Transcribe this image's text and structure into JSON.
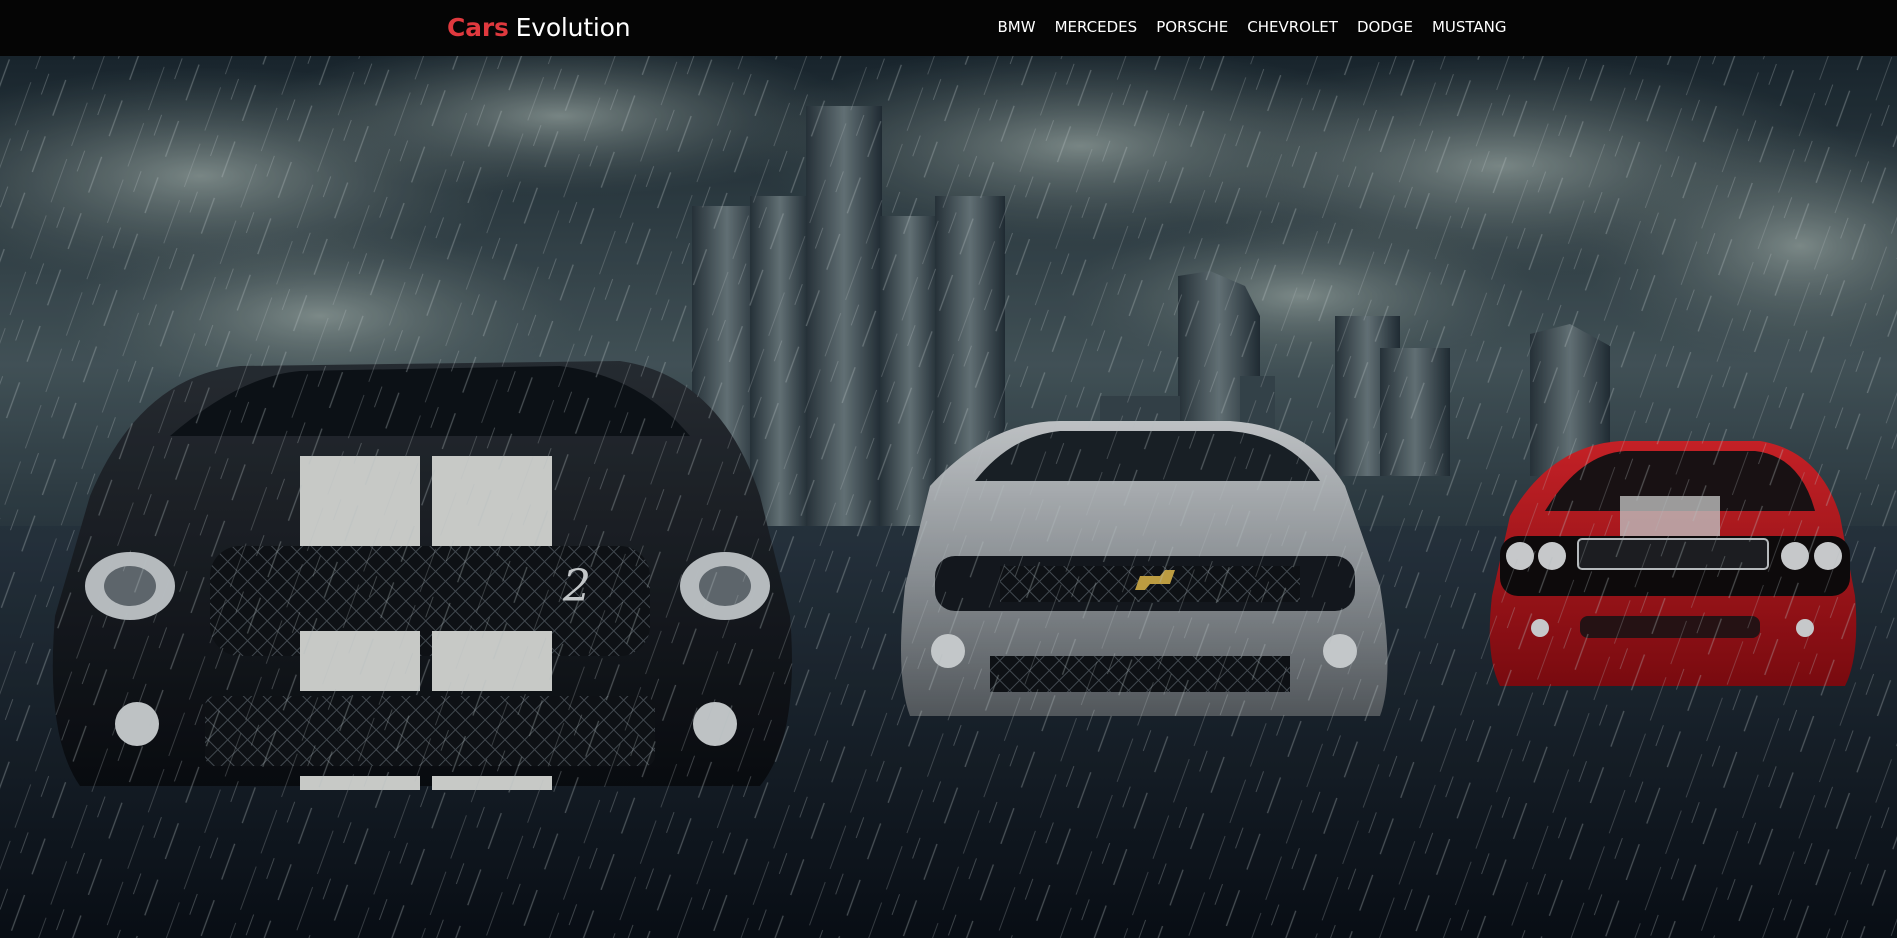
{
  "brand": {
    "accent": "Cars",
    "rest": "Evolution"
  },
  "nav": {
    "items": [
      {
        "label": "BMW"
      },
      {
        "label": "MERCEDES"
      },
      {
        "label": "PORSCHE"
      },
      {
        "label": "CHEVROLET"
      },
      {
        "label": "DODGE"
      },
      {
        "label": "MUSTANG"
      }
    ]
  },
  "hero": {
    "badge": "2"
  },
  "colors": {
    "navbar_bg": "#050505",
    "brand_accent": "#e0393e",
    "nav_text": "#ffffff"
  }
}
